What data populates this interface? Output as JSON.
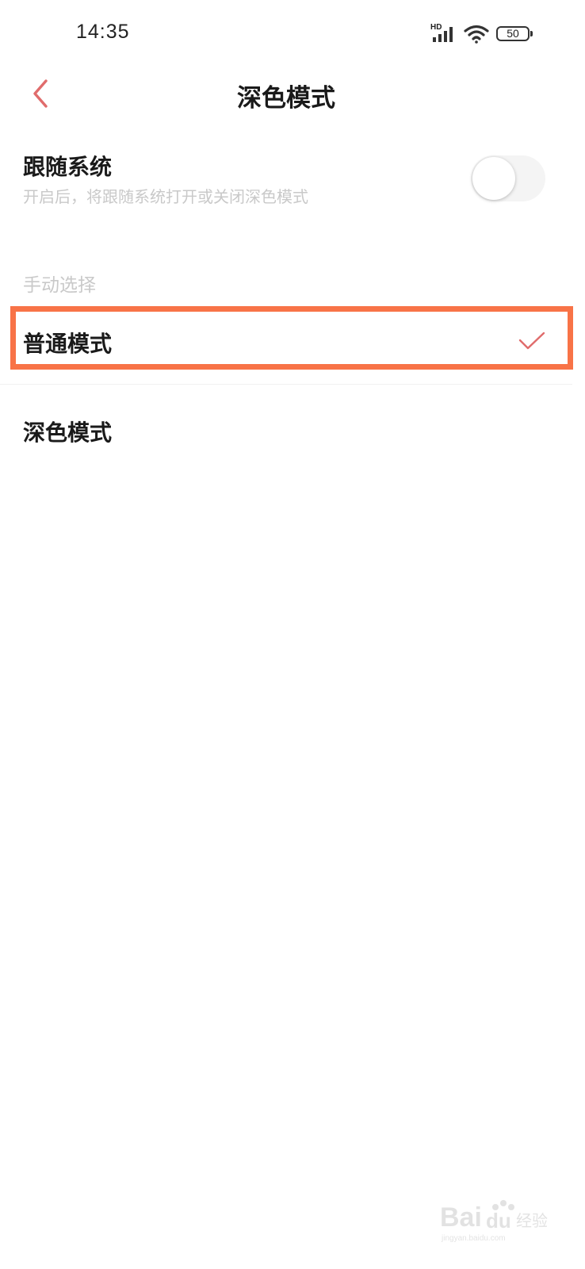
{
  "status_bar": {
    "time": "14:35",
    "network": "HD",
    "battery": "50",
    "icons": [
      "signal-icon",
      "wifi-icon",
      "battery-icon"
    ]
  },
  "header": {
    "title": "深色模式",
    "back_icon": "chevron-left-icon"
  },
  "follow_system": {
    "title": "跟随系统",
    "description": "开启后，将跟随系统打开或关闭深色模式",
    "enabled": false
  },
  "manual": {
    "section_label": "手动选择",
    "options": [
      {
        "label": "普通模式",
        "selected": true
      },
      {
        "label": "深色模式",
        "selected": false
      }
    ]
  },
  "colors": {
    "accent": "#e06c6c",
    "highlight": "#f87347",
    "muted_text": "#c9c9c9"
  },
  "watermark": {
    "brand": "Baidu经验",
    "url": "jingyan.baidu.com"
  }
}
